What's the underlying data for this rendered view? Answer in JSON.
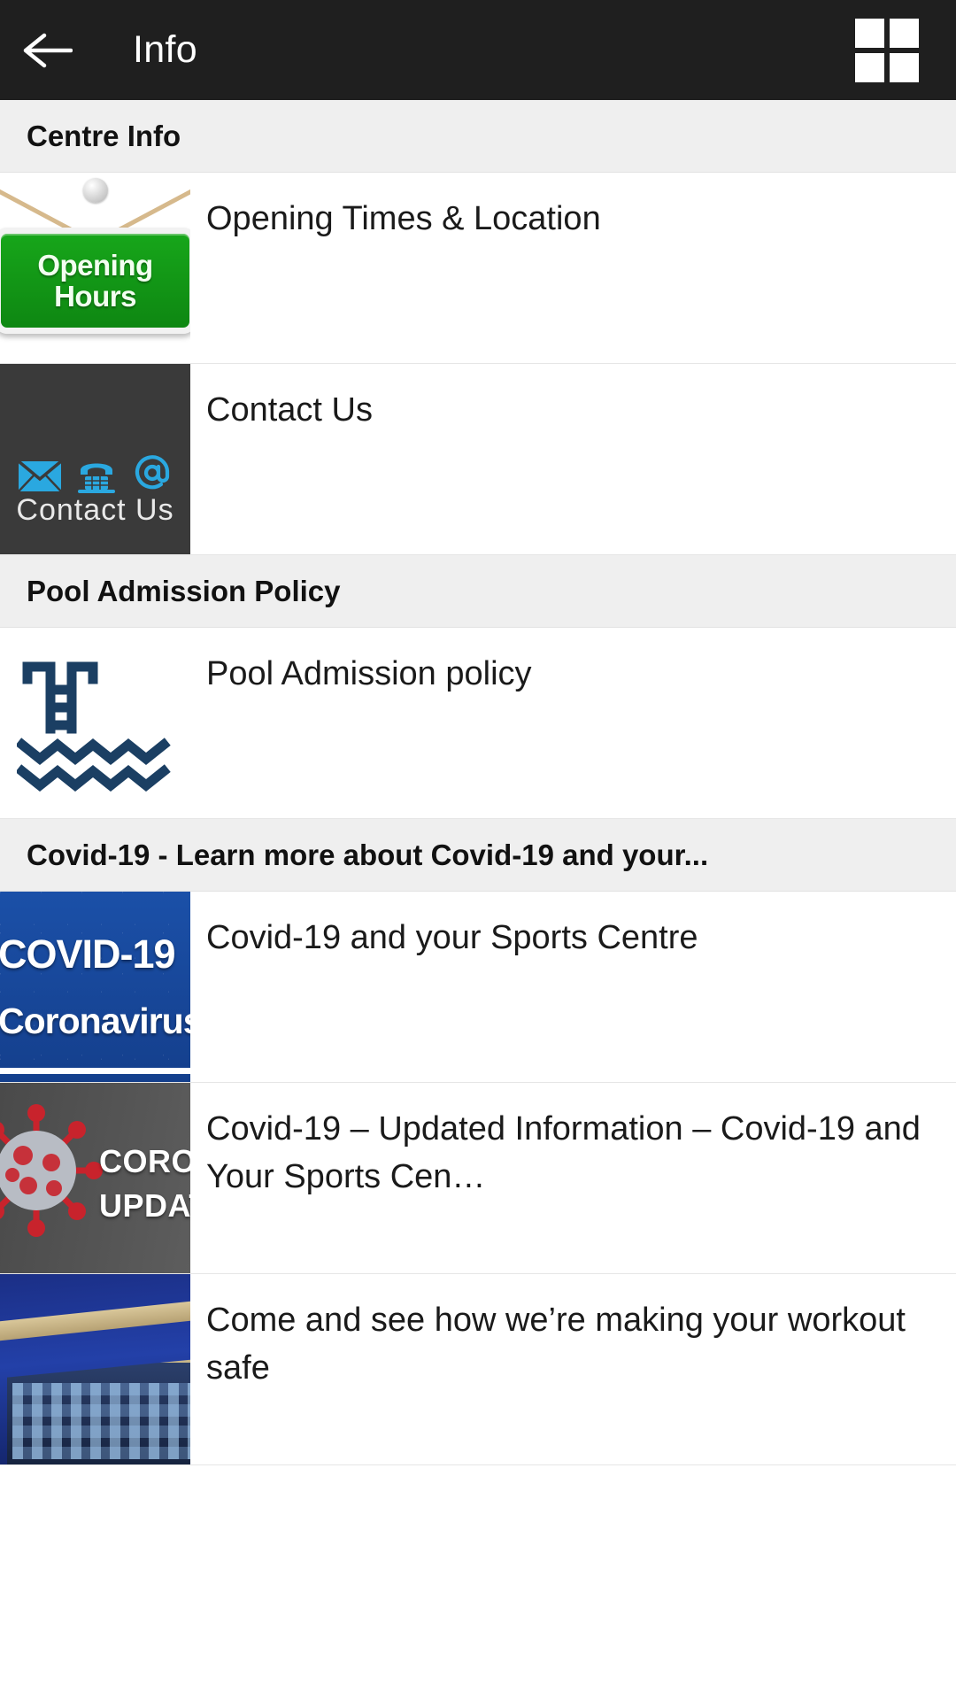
{
  "toolbar": {
    "title": "Info",
    "back_icon": "arrow-left-icon",
    "grid_icon": "grid-2x2-icon"
  },
  "sections": [
    {
      "header": "Centre Info",
      "rows": [
        {
          "label": "Opening Times & Location",
          "thumb_kind": "opening-hours-sign",
          "thumb_text": {
            "line1": "Opening",
            "line2": "Hours"
          },
          "thumb_colors": {
            "sign": "#17a61a",
            "rope": "#d6b98c",
            "text": "#f2fff0"
          }
        },
        {
          "label": "Contact Us",
          "thumb_kind": "contact-us-panel",
          "thumb_text": {
            "caption": "Contact Us"
          },
          "thumb_icons": [
            "envelope-icon",
            "telephone-icon",
            "at-sign-icon"
          ],
          "thumb_colors": {
            "background": "#3a3a3a",
            "icons": "#2aa8e0",
            "caption": "#e9e9e9"
          }
        }
      ]
    },
    {
      "header": "Pool Admission Policy",
      "rows": [
        {
          "label": "Pool Admission policy",
          "thumb_kind": "pool-ladder-icon",
          "thumb_colors": {
            "icon": "#1b3f63",
            "background": "#ffffff"
          }
        }
      ]
    },
    {
      "header": "Covid-19 - Learn more about Covid-19 and your...",
      "rows": [
        {
          "label": "Covid-19 and your Sports Centre",
          "thumb_kind": "covid-banner",
          "thumb_text": {
            "line1": "COVID-19",
            "line2": "Coronavirus"
          },
          "thumb_colors": {
            "background": "#1b50a8",
            "text": "#ffffff"
          }
        },
        {
          "label": "Covid-19 – Updated Information – Covid-19 and Your Sports Cen…",
          "thumb_kind": "coronavirus-update",
          "thumb_text": {
            "line1": "CORO",
            "line2": "UPDAT"
          },
          "thumb_colors": {
            "background": "#555555",
            "virus": "#c8232c",
            "text": "#ffffff"
          }
        },
        {
          "label": "Come and see how we’re making your workout safe",
          "thumb_kind": "building-photo",
          "thumb_colors": {
            "sky": "#1b2f86",
            "building": "#2b3f6b",
            "trim": "#c8b78a"
          }
        }
      ]
    }
  ],
  "colors": {
    "toolbar_bg": "#1f1f1f",
    "section_header_bg": "#efefef",
    "row_bg": "#ffffff",
    "divider": "#e6e6e6",
    "primary_text": "#1a1a1a"
  }
}
